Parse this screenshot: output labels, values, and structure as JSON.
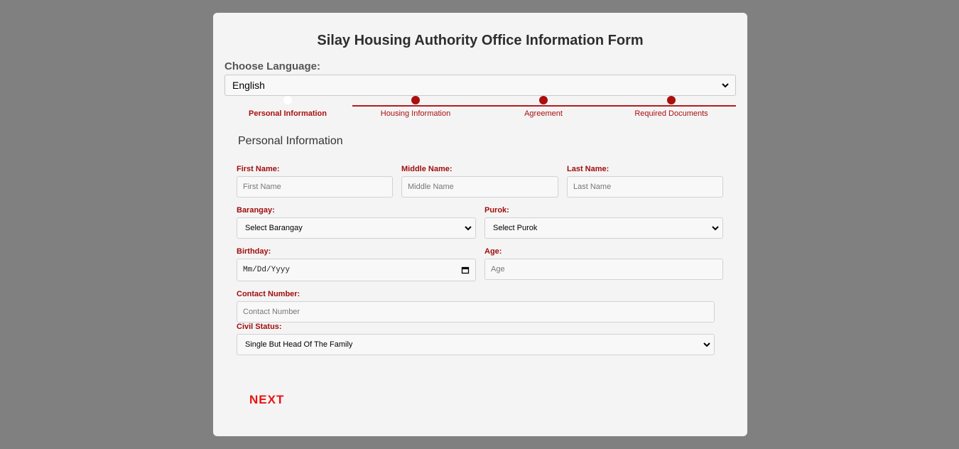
{
  "form": {
    "title": "Silay Housing Authority Office Information Form"
  },
  "language": {
    "label": "Choose Language:",
    "selected": "English"
  },
  "steps": [
    {
      "label": "Personal Information"
    },
    {
      "label": "Housing Information"
    },
    {
      "label": "Agreement"
    },
    {
      "label": "Required Documents"
    }
  ],
  "section": {
    "title": "Personal Information"
  },
  "fields": {
    "first_name": {
      "label": "First Name:",
      "placeholder": "First Name"
    },
    "middle_name": {
      "label": "Middle Name:",
      "placeholder": "Middle Name"
    },
    "last_name": {
      "label": "Last Name:",
      "placeholder": "Last Name"
    },
    "barangay": {
      "label": "Barangay:",
      "selected": "Select Barangay"
    },
    "purok": {
      "label": "Purok:",
      "selected": "Select Purok"
    },
    "birthday": {
      "label": "Birthday:",
      "placeholder": "Mm/Dd/Yyyy"
    },
    "age": {
      "label": "Age:",
      "placeholder": "Age"
    },
    "contact_number": {
      "label": "Contact Number:",
      "placeholder": "Contact Number"
    },
    "civil_status": {
      "label": "Civil Status:",
      "selected": "Single But Head Of The Family"
    }
  },
  "actions": {
    "next_label": "NEXT"
  },
  "colors": {
    "accent": "#a90f0f",
    "next": "#ee1111",
    "backdrop": "#808080",
    "card": "#f4f4f4"
  }
}
